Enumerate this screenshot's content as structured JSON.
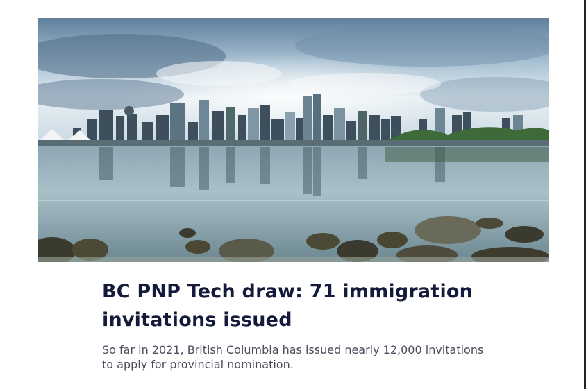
{
  "article": {
    "title": "BC PNP Tech draw: 71 immigration invitations issued",
    "summary": "So far in 2021, British Columbia has issued nearly 12,000 invitations to apply for provincial nomination."
  },
  "colors": {
    "title": "#141a3c",
    "summary": "#4a4e5c"
  }
}
